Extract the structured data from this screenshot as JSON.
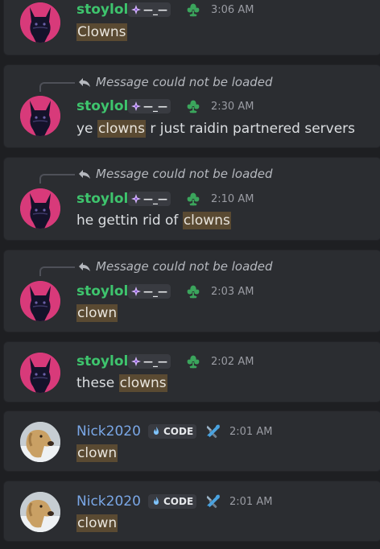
{
  "messages": [
    {
      "author": "stoylol",
      "author_color": "#3ec46d",
      "tag": "—_—",
      "time": "3:06 AM",
      "reply": null,
      "content": [
        {
          "t": "Clowns",
          "hl": true
        }
      ],
      "avatar": "cat-avatar"
    },
    {
      "author": "stoylol",
      "author_color": "#3ec46d",
      "tag": "—_—",
      "time": "2:30 AM",
      "reply": "Message could not be loaded",
      "content": [
        {
          "t": "ye ",
          "hl": false
        },
        {
          "t": "clowns",
          "hl": true
        },
        {
          "t": " r just raidin partnered servers",
          "hl": false
        }
      ],
      "avatar": "cat-avatar"
    },
    {
      "author": "stoylol",
      "author_color": "#3ec46d",
      "tag": "—_—",
      "time": "2:10 AM",
      "reply": "Message could not be loaded",
      "content": [
        {
          "t": "he gettin rid of ",
          "hl": false
        },
        {
          "t": "clowns",
          "hl": true
        }
      ],
      "avatar": "cat-avatar"
    },
    {
      "author": "stoylol",
      "author_color": "#3ec46d",
      "tag": "—_—",
      "time": "2:03 AM",
      "reply": "Message could not be loaded",
      "content": [
        {
          "t": "clown",
          "hl": true
        }
      ],
      "avatar": "cat-avatar"
    },
    {
      "author": "stoylol",
      "author_color": "#3ec46d",
      "tag": "—_—",
      "time": "2:02 AM",
      "reply": null,
      "content": [
        {
          "t": "these ",
          "hl": false
        },
        {
          "t": "clowns",
          "hl": true
        }
      ],
      "avatar": "cat-avatar"
    },
    {
      "author": "Nick2020",
      "author_color": "#7aa7e6",
      "tag": "CODE",
      "time": "2:01 AM",
      "reply": null,
      "content": [
        {
          "t": "clown",
          "hl": true
        }
      ],
      "avatar": "dog-avatar"
    },
    {
      "author": "Nick2020",
      "author_color": "#7aa7e6",
      "tag": "CODE",
      "time": "2:01 AM",
      "reply": null,
      "content": [
        {
          "t": "clown",
          "hl": true
        }
      ],
      "avatar": "dog-avatar"
    }
  ],
  "colors": {
    "highlight": "#5a4a32",
    "background": "#2b2d31",
    "green_icon": "#3ba55c"
  }
}
